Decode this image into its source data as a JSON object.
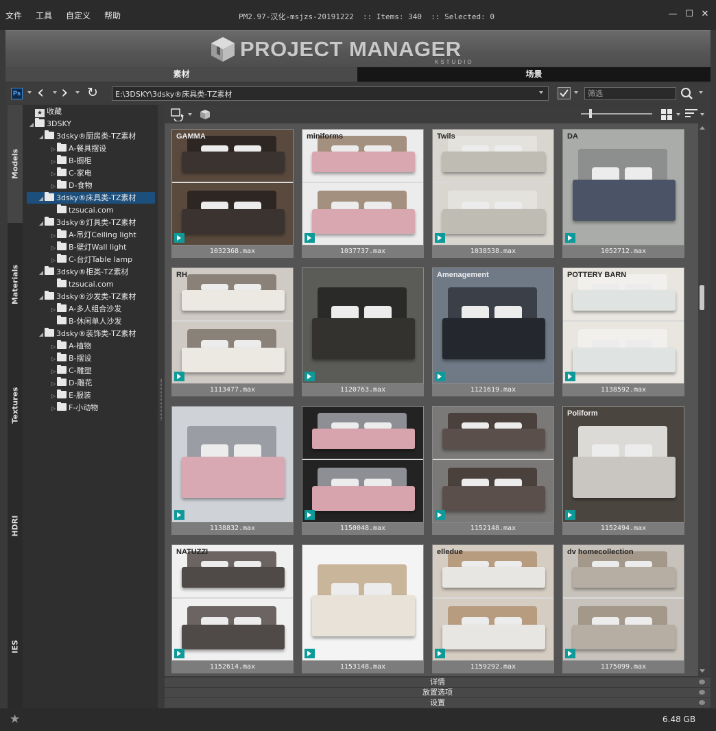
{
  "menu": [
    "文件",
    "工具",
    "自定义",
    "帮助"
  ],
  "window": {
    "title": "PM2.97-汉化-msjzs-20191222  :: Items: 340  :: Selected: 0",
    "minimize": "—",
    "maximize": "☐",
    "close": "✕"
  },
  "banner": {
    "logo": "PROJECT MANAGER",
    "sub": "KSTUDIO"
  },
  "tabs": {
    "assets": "素材",
    "scenes": "场景"
  },
  "nav": {
    "ps": "Ps",
    "back": "‹",
    "forward": "›",
    "refresh": "↻",
    "path": "E:\\3DSKY\\3dsky®床具类-TZ素材",
    "filter_placeholder": "筛选"
  },
  "side_tabs": [
    "Models",
    "Materials",
    "Textures",
    "HDRI",
    "IES"
  ],
  "tree": [
    {
      "label": "收藏",
      "level": 0,
      "tri": "",
      "icon": "star"
    },
    {
      "label": "3DSKY",
      "level": 0,
      "tri": "◢",
      "icon": "folder"
    },
    {
      "label": "3dsky®厨房类-TZ素材",
      "level": 1,
      "tri": "◢",
      "icon": "folder"
    },
    {
      "label": "A-餐具摆设",
      "level": 2,
      "tri": "▷",
      "icon": "folder"
    },
    {
      "label": "B-橱柜",
      "level": 2,
      "tri": "▷",
      "icon": "folder"
    },
    {
      "label": "C-家电",
      "level": 2,
      "tri": "▷",
      "icon": "folder"
    },
    {
      "label": "D-食物",
      "level": 2,
      "tri": "▷",
      "icon": "folder"
    },
    {
      "label": "3dsky®床具类-TZ素材",
      "level": 1,
      "tri": "◢",
      "icon": "folder",
      "selected": true
    },
    {
      "label": "tzsucai.com",
      "level": 2,
      "tri": "",
      "icon": "folder"
    },
    {
      "label": "3dsky®灯具类-TZ素材",
      "level": 1,
      "tri": "◢",
      "icon": "folder"
    },
    {
      "label": "A-吊灯Ceiling light",
      "level": 2,
      "tri": "▷",
      "icon": "folder"
    },
    {
      "label": "B-壁灯Wall light",
      "level": 2,
      "tri": "▷",
      "icon": "folder"
    },
    {
      "label": "C-台灯Table lamp",
      "level": 2,
      "tri": "▷",
      "icon": "folder"
    },
    {
      "label": "3dsky®柜类-TZ素材",
      "level": 1,
      "tri": "◢",
      "icon": "folder"
    },
    {
      "label": "tzsucai.com",
      "level": 2,
      "tri": "",
      "icon": "folder"
    },
    {
      "label": "3dsky®沙发类-TZ素材",
      "level": 1,
      "tri": "◢",
      "icon": "folder"
    },
    {
      "label": "A-多人组合沙发",
      "level": 2,
      "tri": "▷",
      "icon": "folder"
    },
    {
      "label": "B-休闲单人沙发",
      "level": 2,
      "tri": "",
      "icon": "folder"
    },
    {
      "label": "3dsky®装饰类-TZ素材",
      "level": 1,
      "tri": "◢",
      "icon": "folder"
    },
    {
      "label": "A-植物",
      "level": 2,
      "tri": "▷",
      "icon": "folder"
    },
    {
      "label": "B-摆设",
      "level": 2,
      "tri": "▷",
      "icon": "folder"
    },
    {
      "label": "C-雕塑",
      "level": 2,
      "tri": "▷",
      "icon": "folder"
    },
    {
      "label": "D-雕花",
      "level": 2,
      "tri": "▷",
      "icon": "folder"
    },
    {
      "label": "E-服装",
      "level": 2,
      "tri": "▷",
      "icon": "folder"
    },
    {
      "label": "F-小动物",
      "level": 2,
      "tri": "▷",
      "icon": "folder"
    }
  ],
  "items": [
    {
      "file": "1032368.max",
      "bg": "#5a4a3e",
      "bed": "#3b3330",
      "head": "#2e2622",
      "brand": "GAMMA",
      "split": true
    },
    {
      "file": "1037737.max",
      "bg": "#ececec",
      "bed": "#d9a7b0",
      "head": "#a4907f",
      "brand": "miniforms",
      "split": true
    },
    {
      "file": "1038538.max",
      "bg": "#d9d6d0",
      "bed": "#bfbcb4",
      "head": "#e4e2dc",
      "brand": "Twils",
      "split": true
    },
    {
      "file": "1052712.max",
      "bg": "#a9aca9",
      "bed": "#4a5466",
      "head": "#8c8f8d",
      "brand": "DA",
      "split": false
    },
    {
      "file": "1113477.max",
      "bg": "#cfcac4",
      "bed": "#ece8e2",
      "head": "#8a8178",
      "brand": "RH",
      "split": true
    },
    {
      "file": "1120763.max",
      "bg": "#5b5b58",
      "bed": "#33322f",
      "head": "#2a2a28",
      "brand": "",
      "split": false
    },
    {
      "file": "1121619.max",
      "bg": "#6f7a86",
      "bed": "#24272d",
      "head": "#3a3f48",
      "brand": "Amenagement",
      "split": false
    },
    {
      "file": "1138592.max",
      "bg": "#e9e6e0",
      "bed": "#dfe4e2",
      "head": "#f2f0ec",
      "brand": "POTTERY BARN",
      "split": true
    },
    {
      "file": "1138832.max",
      "bg": "#cfd3d8",
      "bed": "#d9a9b3",
      "head": "#9a9ea4",
      "brand": "",
      "split": false
    },
    {
      "file": "1150048.max",
      "bg": "#232323",
      "bed": "#d7a3ad",
      "head": "#8d8f94",
      "brand": "",
      "split": true
    },
    {
      "file": "1152148.max",
      "bg": "#7b7977",
      "bed": "#5a4f4b",
      "head": "#4a403c",
      "brand": "",
      "split": true
    },
    {
      "file": "1152494.max",
      "bg": "#4b4540",
      "bed": "#c9c6c1",
      "head": "#dcdad6",
      "brand": "Poliform",
      "split": false
    },
    {
      "file": "1152614.max",
      "bg": "#f0f0f0",
      "bed": "#4f4a48",
      "head": "#6b6462",
      "brand": "NATUZZI",
      "split": true
    },
    {
      "file": "1153148.max",
      "bg": "#f4f4f4",
      "bed": "#e8e2d8",
      "head": "#c9b59a",
      "brand": "",
      "split": false
    },
    {
      "file": "1159292.max",
      "bg": "#d6cdc2",
      "bed": "#e8e6e2",
      "head": "#b89c80",
      "brand": "elledue",
      "split": true
    },
    {
      "file": "1175099.max",
      "bg": "#c7c2bb",
      "bed": "#b7aea3",
      "head": "#a39889",
      "brand": "dv homecollection",
      "split": true
    }
  ],
  "panels": {
    "details": "详情",
    "placement": "放置选项",
    "settings": "设置"
  },
  "status": {
    "disk": "6.48 GB"
  }
}
